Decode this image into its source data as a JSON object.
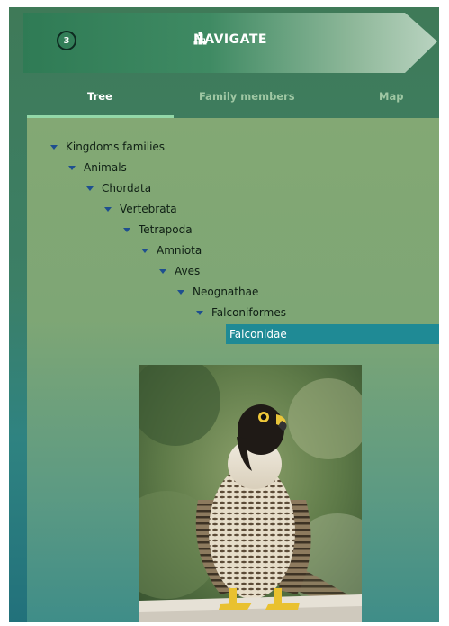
{
  "banner": {
    "step_number": "3",
    "title": "NAVIGATE"
  },
  "tabs": [
    {
      "label": "Tree",
      "active": true
    },
    {
      "label": "Family members",
      "active": false
    },
    {
      "label": "Map",
      "active": false
    }
  ],
  "tree": [
    {
      "label": "Kingdoms families",
      "depth": 0,
      "expanded": true
    },
    {
      "label": "Animals",
      "depth": 1,
      "expanded": true
    },
    {
      "label": "Chordata",
      "depth": 2,
      "expanded": true
    },
    {
      "label": "Vertebrata",
      "depth": 3,
      "expanded": true
    },
    {
      "label": "Tetrapoda",
      "depth": 4,
      "expanded": true
    },
    {
      "label": "Amniota",
      "depth": 5,
      "expanded": true
    },
    {
      "label": "Aves",
      "depth": 6,
      "expanded": true
    },
    {
      "label": "Neognathae",
      "depth": 7,
      "expanded": true
    },
    {
      "label": "Falconiformes",
      "depth": 8,
      "expanded": true
    },
    {
      "label": "Falconidae",
      "depth": 9,
      "selected": true
    }
  ],
  "colors": {
    "accent": "#1f8a95",
    "tab_underline": "#93d8a8",
    "caret": "#1e4f8f"
  },
  "photo": {
    "icon": "falcon-photo"
  }
}
